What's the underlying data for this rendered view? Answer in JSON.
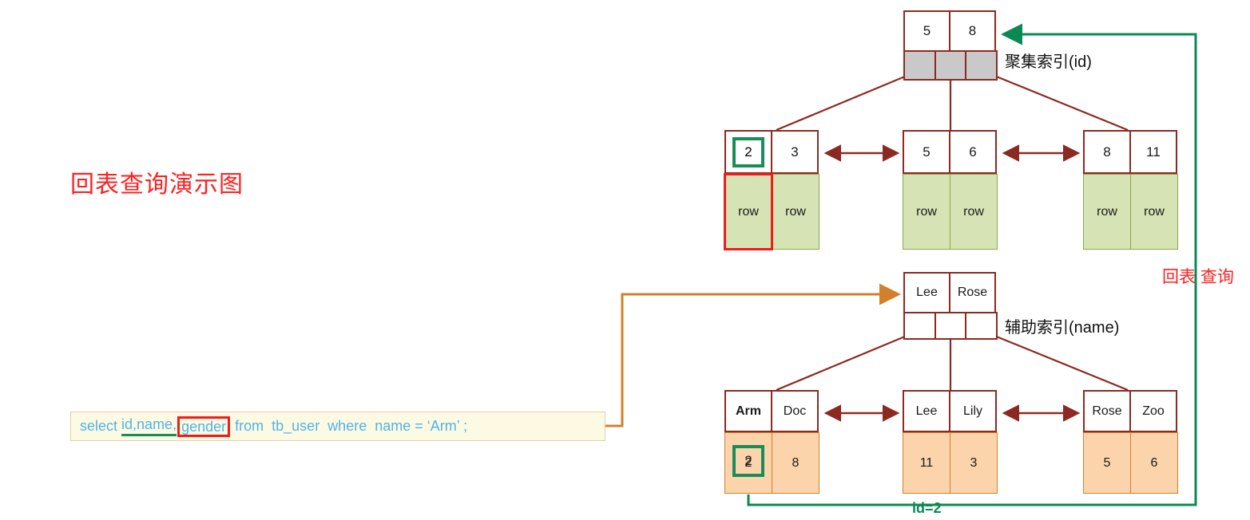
{
  "title": "回表查询演示图",
  "labels": {
    "clustered_index": "聚集索引(id)",
    "secondary_index": "辅助索引(name)",
    "lookup": "回表 查询",
    "id_result": "id=2"
  },
  "sql": {
    "part_select": "select ",
    "part_cols_underlined": "id,name,",
    "part_col_boxed": "gender",
    "part_rest": " from  tb_user  where  name = ‘Arm’ ;"
  },
  "colors": {
    "node_border": "#8c2a22",
    "pointer_fill": "#c9c9c9",
    "row_fill": "#d5e3b5",
    "row_border": "#8aa84b",
    "value_fill": "#fbd4ab",
    "value_border": "#d2802a",
    "highlight_green": "#1a8c5a",
    "highlight_red": "#ee1c1c",
    "arrow_dark_red": "#8c2a22",
    "arrow_orange": "#d2802a",
    "arrow_green": "#0a8a52",
    "title_red": "#ff2020",
    "sql_text": "#4fb3e8",
    "sql_bg": "#fdfae4"
  },
  "clustered_index": {
    "root": {
      "keys": [
        "5",
        "8"
      ],
      "pointers": [
        "ptr",
        "ptr",
        "ptr"
      ]
    },
    "leaves": [
      {
        "keys": [
          "2",
          "3"
        ],
        "values": [
          "row",
          "row"
        ],
        "highlight_key": "2",
        "highlight_value_index": 0
      },
      {
        "keys": [
          "5",
          "6"
        ],
        "values": [
          "row",
          "row"
        ]
      },
      {
        "keys": [
          "8",
          "11"
        ],
        "values": [
          "row",
          "row"
        ]
      }
    ]
  },
  "secondary_index": {
    "root": {
      "keys": [
        "Lee",
        "Rose"
      ],
      "pointers": [
        "ptr",
        "ptr",
        "ptr"
      ]
    },
    "leaves": [
      {
        "keys": [
          "Arm",
          "Doc"
        ],
        "values": [
          "2",
          "8"
        ],
        "bold_key_index": 0,
        "highlight_value": "2"
      },
      {
        "keys": [
          "Lee",
          "Lily"
        ],
        "values": [
          "11",
          "3"
        ]
      },
      {
        "keys": [
          "Rose",
          "Zoo"
        ],
        "values": [
          "5",
          "6"
        ]
      }
    ]
  }
}
